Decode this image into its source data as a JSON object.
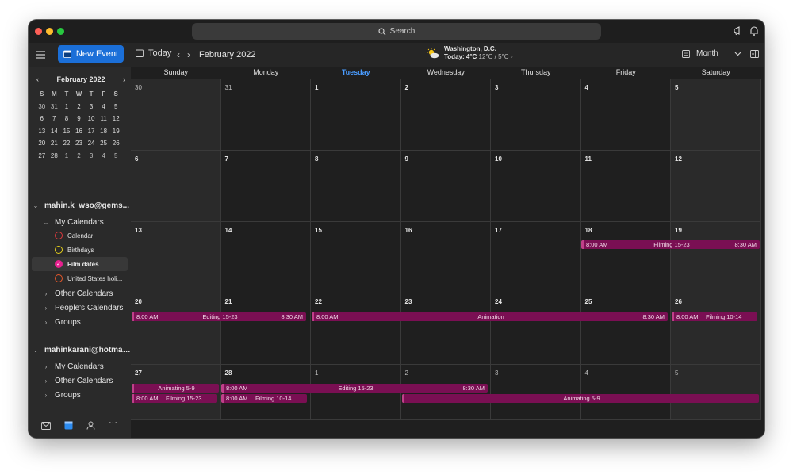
{
  "titlebar": {
    "search_placeholder": "Search"
  },
  "toolbar": {
    "new_event_label": "New Event",
    "today_label": "Today",
    "prev_arrow": "‹",
    "next_arrow": "›",
    "current_period": "February 2022",
    "weather": {
      "location": "Washington,  D.C.",
      "today_label": "Today:",
      "temp": "4°C",
      "range": "12°C / 5°C"
    },
    "view_label": "Month"
  },
  "mini_calendar": {
    "title": "February 2022",
    "prev": "‹",
    "next": "›",
    "weekdays": [
      "S",
      "M",
      "T",
      "W",
      "T",
      "F",
      "S"
    ],
    "weeks": [
      [
        "30",
        "31",
        "1",
        "2",
        "3",
        "4",
        "5"
      ],
      [
        "6",
        "7",
        "8",
        "9",
        "10",
        "11",
        "12"
      ],
      [
        "13",
        "14",
        "15",
        "16",
        "17",
        "18",
        "19"
      ],
      [
        "20",
        "21",
        "22",
        "23",
        "24",
        "25",
        "26"
      ],
      [
        "27",
        "28",
        "1",
        "2",
        "3",
        "4",
        "5"
      ]
    ]
  },
  "sidebar": {
    "account1": "mahin.k_wso@gems...",
    "my_calendars": "My Calendars",
    "calendars": [
      {
        "label": "Calendar",
        "color": "#e0393e"
      },
      {
        "label": "Birthdays",
        "color": "#e8d21a"
      },
      {
        "label": "Film dates",
        "color": "#e8208f"
      },
      {
        "label": "United States holi...",
        "color": "#e5582a"
      }
    ],
    "other_calendars": "Other Calendars",
    "peoples_calendars": "People's Calendars",
    "groups": "Groups",
    "account2": "mahinkarani@hotmai...",
    "my_calendars2": "My Calendars",
    "other_calendars2": "Other Calendars",
    "groups2": "Groups"
  },
  "calendar": {
    "weekdays": [
      "Sunday",
      "Monday",
      "Tuesday",
      "Wednesday",
      "Thursday",
      "Friday",
      "Saturday"
    ],
    "weeks": [
      [
        "30",
        "31",
        "1",
        "2",
        "3",
        "4",
        "5"
      ],
      [
        "6",
        "7",
        "8",
        "9",
        "10",
        "11",
        "12"
      ],
      [
        "13",
        "14",
        "15",
        "16",
        "17",
        "18",
        "19"
      ],
      [
        "20",
        "21",
        "22",
        "23",
        "24",
        "25",
        "26"
      ],
      [
        "27",
        "28",
        "1",
        "2",
        "3",
        "4",
        "5"
      ]
    ],
    "events": {
      "filming_15_23_a": {
        "start": "8:00 AM",
        "title": "Filming 15-23",
        "end": "8:30 AM"
      },
      "editing_15_23_a": {
        "start": "8:00 AM",
        "title": "Editing 15-23",
        "end": "8:30 AM"
      },
      "animation": {
        "start": "8:00 AM",
        "title": "Animation",
        "end": "8:30 AM"
      },
      "filming_10_14_a": {
        "start": "8:00 AM",
        "title": "Filming 10-14"
      },
      "animating_5_9_a": {
        "title": "Animating 5-9"
      },
      "filming_15_23_b": {
        "start": "8:00 AM",
        "title": "Filming 15-23"
      },
      "editing_15_23_b": {
        "start": "8:00 AM",
        "title": "Editing 15-23",
        "end": "8:30 AM"
      },
      "filming_10_14_b": {
        "start": "8:00 AM",
        "title": "Filming 10-14"
      },
      "animating_5_9_b": {
        "title": "Animating 5-9"
      }
    }
  }
}
